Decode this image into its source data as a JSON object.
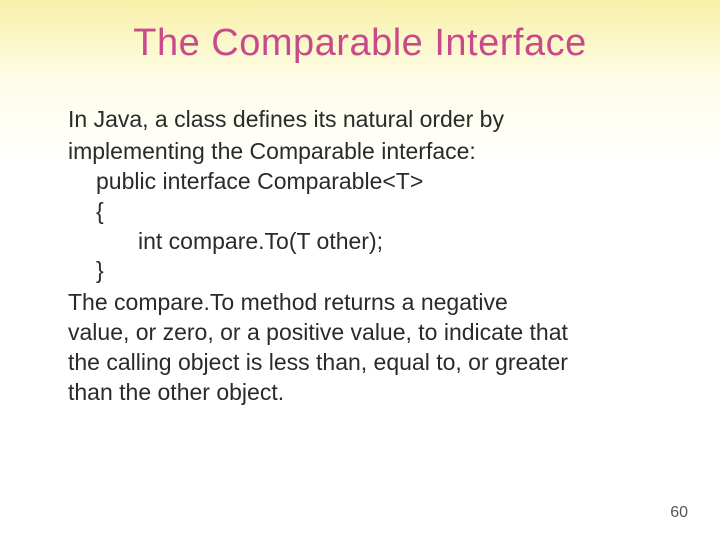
{
  "title": "The Comparable Interface",
  "body": {
    "intro1": "In Java, a class defines its natural order by",
    "intro2": "implementing the Comparable interface:",
    "code1": "public interface Comparable<T>",
    "code2": "{",
    "code3": "int compare.To(T other);",
    "code4": "}",
    "outro1": "The compare.To method returns a negative",
    "outro2": "value, or zero, or a positive value, to indicate that",
    "outro3": "the calling object is less than, equal to, or greater",
    "outro4": "than the other object."
  },
  "page_number": "60"
}
